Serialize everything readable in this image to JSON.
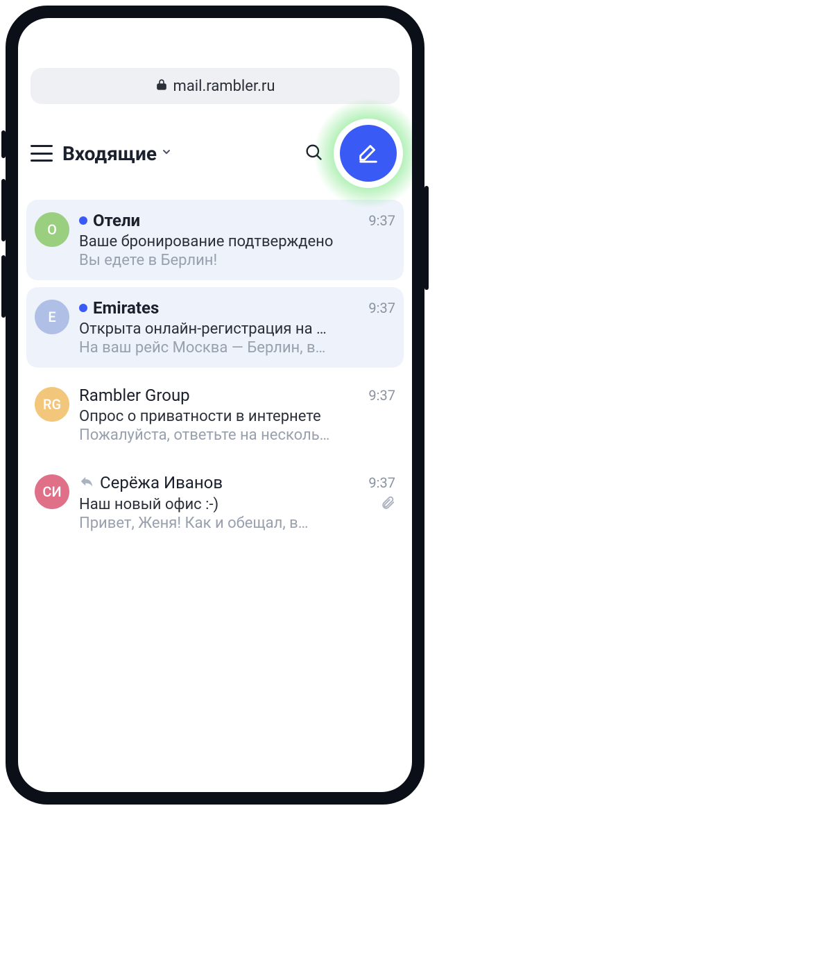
{
  "url_bar": {
    "domain": "mail.rambler.ru"
  },
  "toolbar": {
    "folder_title": "Входящие"
  },
  "colors": {
    "accent": "#3a5af6",
    "glow": "#38d944"
  },
  "messages": [
    {
      "avatar_initials": "O",
      "avatar_color": "#9acf7f",
      "sender": "Отели",
      "time": "9:37",
      "subject": "Ваше бронирование подтверждено",
      "preview": "Вы едете в Берлин!",
      "unread": true,
      "reply": false,
      "attachment": false
    },
    {
      "avatar_initials": "E",
      "avatar_color": "#b0bfe6",
      "sender": "Emirates",
      "time": "9:37",
      "subject": "Открыта онлайн-регистрация на …",
      "preview": "На ваш рейс Москва — Берлин, в…",
      "unread": true,
      "reply": false,
      "attachment": false
    },
    {
      "avatar_initials": "RG",
      "avatar_color": "#f2c67b",
      "sender": "Rambler Group",
      "time": "9:37",
      "subject": "Опрос о приватности в интернете",
      "preview": "Пожалуйста, ответьте на несколь…",
      "unread": false,
      "reply": false,
      "attachment": false
    },
    {
      "avatar_initials": "СИ",
      "avatar_color": "#e07088",
      "sender": "Серёжа Иванов",
      "time": "9:37",
      "subject": "Наш новый офис :-)",
      "preview": "Привет, Женя! Как и обещал, в…",
      "unread": false,
      "reply": true,
      "attachment": true
    }
  ]
}
